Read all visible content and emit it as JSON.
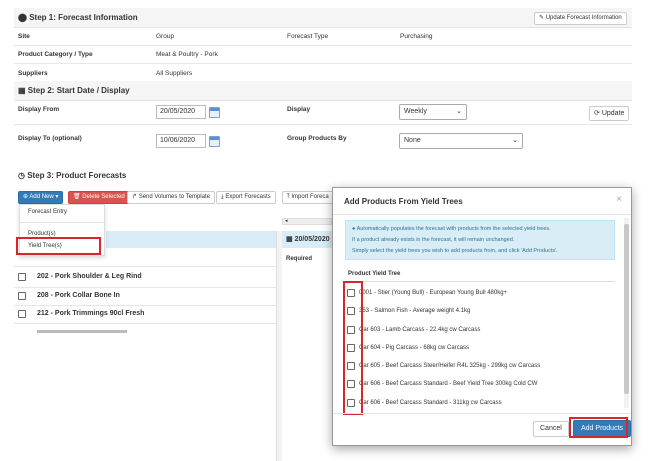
{
  "step1": {
    "title": "Step 1: Forecast Information",
    "update_btn": "Update Forecast Information",
    "site_label": "Site",
    "group_label": "Group",
    "forecast_type_label": "Forecast Type",
    "forecast_type_value": "Purchasing",
    "category_label": "Product Category / Type",
    "category_value": "Meat & Poultry - Pork",
    "suppliers_label": "Suppliers",
    "suppliers_value": "All Suppliers"
  },
  "step2": {
    "title": "Step 2: Start Date / Display",
    "display_from_label": "Display From",
    "display_from_value": "20/05/2020",
    "display_label": "Display",
    "display_value": "Weekly",
    "update_btn": "Update",
    "display_to_label": "Display To (optional)",
    "display_to_value": "10/06/2020",
    "group_by_label": "Group Products By",
    "group_by_value": "None"
  },
  "step3": {
    "title": "Step 3: Product Forecasts",
    "add_new": "Add New",
    "delete_selected": "Delete Selected",
    "send_volumes": "Send Volumes to Template",
    "export": "Export Forecasts",
    "import": "Import Foreca",
    "date_header": "20/05/2020",
    "required_label": "Required",
    "products": [
      "202 - Pork Shoulder & Leg Rind",
      "208 - Pork Collar Bone In",
      "212 - Pork Trimmings 90cl Fresh"
    ]
  },
  "dropdown": {
    "items": [
      "Forecast Entry",
      "Product(s)",
      "Yield Tree(s)"
    ]
  },
  "modal": {
    "title": "Add Products From Yield Trees",
    "close": "×",
    "info_line1": "Automatically populates the forecast with products from the selected yield trees.",
    "info_line2": "If a product already exists in the forecast, it will remain unchanged.",
    "info_line3": "Simply select the yield trees you wish to add products from, and click 'Add Products'.",
    "tree_header": "Product Yield Tree",
    "trees": [
      "0001 - Stier (Young Bull) - European Young Bull 480kg+",
      "353 - Salmon Fish - Average weight 4.1kg",
      "Car 603 - Lamb Carcass - 22.4kg cw Carcass",
      "Car 604 - Pig Carcass - 68kg cw Carcass",
      "Car 605 - Beef Carcass Steer/Heifer R4L 325kg - 299kg cw Carcass",
      "Car 606 - Beef Carcass Standard - Beef Yield Tree 300kg Cold CW",
      "Car 606 - Beef Carcass Standard - 311kg cw Carcass"
    ],
    "cancel": "Cancel",
    "add_products": "Add Products"
  },
  "colors": {
    "primary": "#337ab7",
    "danger": "#d9534f",
    "highlight": "#d9262c",
    "info_bg": "#d9edf7"
  }
}
